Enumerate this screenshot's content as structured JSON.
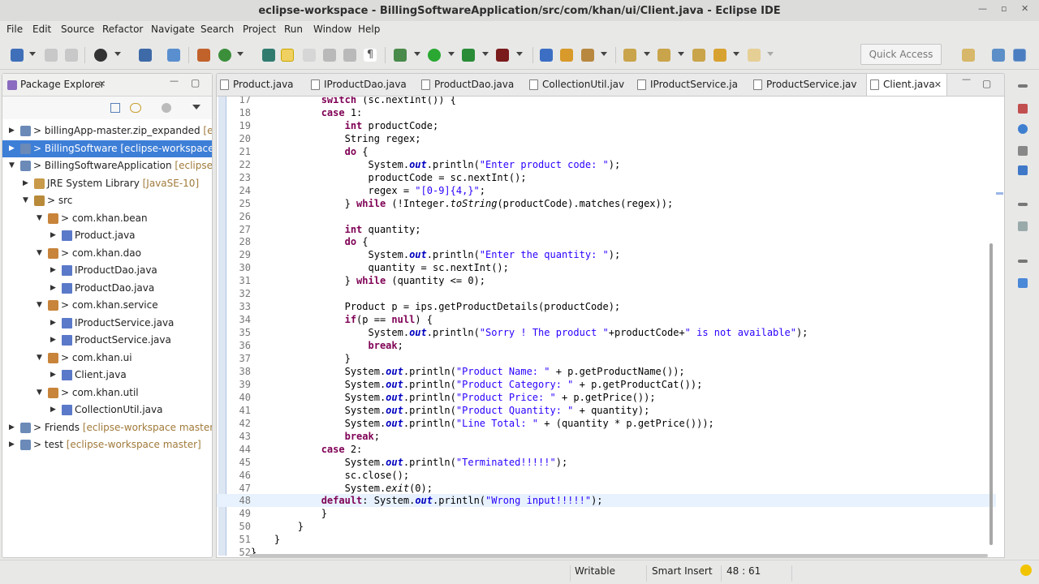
{
  "window": {
    "title": "eclipse-workspace - BillingSoftwareApplication/src/com/khan/ui/Client.java - Eclipse IDE"
  },
  "menu": [
    "File",
    "Edit",
    "Source",
    "Refactor",
    "Navigate",
    "Search",
    "Project",
    "Run",
    "Window",
    "Help"
  ],
  "toolbar": {
    "quick_access_placeholder": "Quick Access"
  },
  "package_explorer": {
    "title": "Package Explorer",
    "items": [
      {
        "text": "> billingApp-master.zip_expanded",
        "decoration": " [eclipse",
        "level": 0,
        "twisty": "▶",
        "icon": "project-icon"
      },
      {
        "text": "> BillingSoftware",
        "decoration": " [eclipse-workspace mast",
        "level": 0,
        "twisty": "▶",
        "icon": "project-icon",
        "selected": true
      },
      {
        "text": "> BillingSoftwareApplication",
        "decoration": " [eclipse-work",
        "level": 0,
        "twisty": "▼",
        "icon": "project-icon"
      },
      {
        "text": "JRE System Library",
        "decoration": " [JavaSE-10]",
        "level": 1,
        "twisty": "▶",
        "icon": "library-icon"
      },
      {
        "text": "> src",
        "decoration": "",
        "level": 1,
        "twisty": "▼",
        "icon": "source-folder-icon"
      },
      {
        "text": "> com.khan.bean",
        "decoration": "",
        "level": 2,
        "twisty": "▼",
        "icon": "package-icon"
      },
      {
        "text": "Product.java",
        "decoration": "",
        "level": 3,
        "twisty": "▶",
        "icon": "java-file-icon"
      },
      {
        "text": "> com.khan.dao",
        "decoration": "",
        "level": 2,
        "twisty": "▼",
        "icon": "package-icon"
      },
      {
        "text": "IProductDao.java",
        "decoration": "",
        "level": 3,
        "twisty": "▶",
        "icon": "java-file-icon"
      },
      {
        "text": "ProductDao.java",
        "decoration": "",
        "level": 3,
        "twisty": "▶",
        "icon": "java-file-icon"
      },
      {
        "text": "> com.khan.service",
        "decoration": "",
        "level": 2,
        "twisty": "▼",
        "icon": "package-icon"
      },
      {
        "text": "IProductService.java",
        "decoration": "",
        "level": 3,
        "twisty": "▶",
        "icon": "java-file-icon"
      },
      {
        "text": "ProductService.java",
        "decoration": "",
        "level": 3,
        "twisty": "▶",
        "icon": "java-file-icon"
      },
      {
        "text": "> com.khan.ui",
        "decoration": "",
        "level": 2,
        "twisty": "▼",
        "icon": "package-icon"
      },
      {
        "text": "Client.java",
        "decoration": "",
        "level": 3,
        "twisty": "▶",
        "icon": "java-file-icon"
      },
      {
        "text": "> com.khan.util",
        "decoration": "",
        "level": 2,
        "twisty": "▼",
        "icon": "package-icon"
      },
      {
        "text": "CollectionUtil.java",
        "decoration": "",
        "level": 3,
        "twisty": "▶",
        "icon": "java-file-icon"
      },
      {
        "text": "> Friends",
        "decoration": " [eclipse-workspace master]",
        "level": 0,
        "twisty": "▶",
        "icon": "project-icon"
      },
      {
        "text": "> test",
        "decoration": " [eclipse-workspace master]",
        "level": 0,
        "twisty": "▶",
        "icon": "project-icon"
      }
    ]
  },
  "editor": {
    "tabs": [
      {
        "label": "Product.java"
      },
      {
        "label": "IProductDao.java"
      },
      {
        "label": "ProductDao.java"
      },
      {
        "label": "CollectionUtil.jav"
      },
      {
        "label": "IProductService.ja"
      },
      {
        "label": "ProductService.jav"
      },
      {
        "label": "Client.java",
        "active": true
      }
    ],
    "current_line": 48,
    "lines": [
      {
        "n": "17",
        "segs": [
          [
            "            ",
            ""
          ],
          [
            "switch",
            "kw"
          ],
          [
            " (sc.nextInt()) {",
            ""
          ]
        ]
      },
      {
        "n": "18",
        "segs": [
          [
            "            ",
            ""
          ],
          [
            "case",
            "kw"
          ],
          [
            " 1:",
            ""
          ]
        ]
      },
      {
        "n": "19",
        "segs": [
          [
            "                ",
            ""
          ],
          [
            "int",
            "kw"
          ],
          [
            " productCode;",
            ""
          ]
        ]
      },
      {
        "n": "20",
        "segs": [
          [
            "                String regex;",
            ""
          ]
        ]
      },
      {
        "n": "21",
        "segs": [
          [
            "                ",
            ""
          ],
          [
            "do",
            "kw"
          ],
          [
            " {",
            ""
          ]
        ]
      },
      {
        "n": "22",
        "segs": [
          [
            "                    System.",
            ""
          ],
          [
            "out",
            "fld"
          ],
          [
            ".println(",
            ""
          ],
          [
            "\"Enter product code: \"",
            "str"
          ],
          [
            ");",
            ""
          ]
        ]
      },
      {
        "n": "23",
        "segs": [
          [
            "                    productCode = sc.nextInt();",
            ""
          ]
        ]
      },
      {
        "n": "24",
        "segs": [
          [
            "                    regex = ",
            ""
          ],
          [
            "\"[0-9]{4,}\"",
            "str"
          ],
          [
            ";",
            ""
          ]
        ]
      },
      {
        "n": "25",
        "segs": [
          [
            "                } ",
            ""
          ],
          [
            "while",
            "kw"
          ],
          [
            " (!Integer.",
            ""
          ],
          [
            "toString",
            "sm"
          ],
          [
            "(productCode).matches(regex));",
            ""
          ]
        ]
      },
      {
        "n": "26",
        "segs": [
          [
            "",
            ""
          ]
        ]
      },
      {
        "n": "27",
        "segs": [
          [
            "                ",
            ""
          ],
          [
            "int",
            "kw"
          ],
          [
            " quantity;",
            ""
          ]
        ]
      },
      {
        "n": "28",
        "segs": [
          [
            "                ",
            ""
          ],
          [
            "do",
            "kw"
          ],
          [
            " {",
            ""
          ]
        ]
      },
      {
        "n": "29",
        "segs": [
          [
            "                    System.",
            ""
          ],
          [
            "out",
            "fld"
          ],
          [
            ".println(",
            ""
          ],
          [
            "\"Enter the quantity: \"",
            "str"
          ],
          [
            ");",
            ""
          ]
        ]
      },
      {
        "n": "30",
        "segs": [
          [
            "                    quantity = sc.nextInt();",
            ""
          ]
        ]
      },
      {
        "n": "31",
        "segs": [
          [
            "                } ",
            ""
          ],
          [
            "while",
            "kw"
          ],
          [
            " (quantity <= 0);",
            ""
          ]
        ]
      },
      {
        "n": "32",
        "segs": [
          [
            "",
            ""
          ]
        ]
      },
      {
        "n": "33",
        "segs": [
          [
            "                Product p = ips.getProductDetails(productCode);",
            ""
          ]
        ]
      },
      {
        "n": "34",
        "segs": [
          [
            "                ",
            ""
          ],
          [
            "if",
            "kw"
          ],
          [
            "(p == ",
            ""
          ],
          [
            "null",
            "kw"
          ],
          [
            ") {",
            ""
          ]
        ]
      },
      {
        "n": "35",
        "segs": [
          [
            "                    System.",
            ""
          ],
          [
            "out",
            "fld"
          ],
          [
            ".println(",
            ""
          ],
          [
            "\"Sorry ! The product \"",
            "str"
          ],
          [
            "+productCode+",
            ""
          ],
          [
            "\" is not available\"",
            "str"
          ],
          [
            ");",
            ""
          ]
        ]
      },
      {
        "n": "36",
        "segs": [
          [
            "                    ",
            ""
          ],
          [
            "break",
            "kw"
          ],
          [
            ";",
            ""
          ]
        ]
      },
      {
        "n": "37",
        "segs": [
          [
            "                }",
            ""
          ]
        ]
      },
      {
        "n": "38",
        "segs": [
          [
            "                System.",
            ""
          ],
          [
            "out",
            "fld"
          ],
          [
            ".println(",
            ""
          ],
          [
            "\"Product Name: \"",
            "str"
          ],
          [
            " + p.getProductName());",
            ""
          ]
        ]
      },
      {
        "n": "39",
        "segs": [
          [
            "                System.",
            ""
          ],
          [
            "out",
            "fld"
          ],
          [
            ".println(",
            ""
          ],
          [
            "\"Product Category: \"",
            "str"
          ],
          [
            " + p.getProductCat());",
            ""
          ]
        ]
      },
      {
        "n": "40",
        "segs": [
          [
            "                System.",
            ""
          ],
          [
            "out",
            "fld"
          ],
          [
            ".println(",
            ""
          ],
          [
            "\"Product Price: \"",
            "str"
          ],
          [
            " + p.getPrice());",
            ""
          ]
        ]
      },
      {
        "n": "41",
        "segs": [
          [
            "                System.",
            ""
          ],
          [
            "out",
            "fld"
          ],
          [
            ".println(",
            ""
          ],
          [
            "\"Product Quantity: \"",
            "str"
          ],
          [
            " + quantity);",
            ""
          ]
        ]
      },
      {
        "n": "42",
        "segs": [
          [
            "                System.",
            ""
          ],
          [
            "out",
            "fld"
          ],
          [
            ".println(",
            ""
          ],
          [
            "\"Line Total: \"",
            "str"
          ],
          [
            " + (quantity * p.getPrice()));",
            ""
          ]
        ]
      },
      {
        "n": "43",
        "segs": [
          [
            "                ",
            ""
          ],
          [
            "break",
            "kw"
          ],
          [
            ";",
            ""
          ]
        ]
      },
      {
        "n": "44",
        "segs": [
          [
            "            ",
            ""
          ],
          [
            "case",
            "kw"
          ],
          [
            " 2:",
            ""
          ]
        ]
      },
      {
        "n": "45",
        "segs": [
          [
            "                System.",
            ""
          ],
          [
            "out",
            "fld"
          ],
          [
            ".println(",
            ""
          ],
          [
            "\"Terminated!!!!!\"",
            "str"
          ],
          [
            ");",
            ""
          ]
        ]
      },
      {
        "n": "46",
        "segs": [
          [
            "                sc.close();",
            ""
          ]
        ]
      },
      {
        "n": "47",
        "segs": [
          [
            "                System.",
            ""
          ],
          [
            "exit",
            "sm"
          ],
          [
            "(0);",
            ""
          ]
        ]
      },
      {
        "n": "48",
        "segs": [
          [
            "            ",
            ""
          ],
          [
            "default",
            "kw"
          ],
          [
            ": System.",
            ""
          ],
          [
            "out",
            "fld"
          ],
          [
            ".println(",
            ""
          ],
          [
            "\"Wrong input!!!!!\"",
            "str"
          ],
          [
            ");",
            ""
          ]
        ]
      },
      {
        "n": "49",
        "segs": [
          [
            "            }",
            ""
          ]
        ]
      },
      {
        "n": "50",
        "segs": [
          [
            "        }",
            ""
          ]
        ]
      },
      {
        "n": "51",
        "segs": [
          [
            "    }",
            ""
          ]
        ]
      },
      {
        "n": "52",
        "segs": [
          [
            "}",
            ""
          ]
        ]
      }
    ]
  },
  "status": {
    "writable": "Writable",
    "insert_mode": "Smart Insert",
    "position": "48 : 61"
  },
  "colors": {
    "selection": "#3d7ed7",
    "keyword": "#7f0055",
    "string": "#2a00ff",
    "field": "#0000c0"
  }
}
